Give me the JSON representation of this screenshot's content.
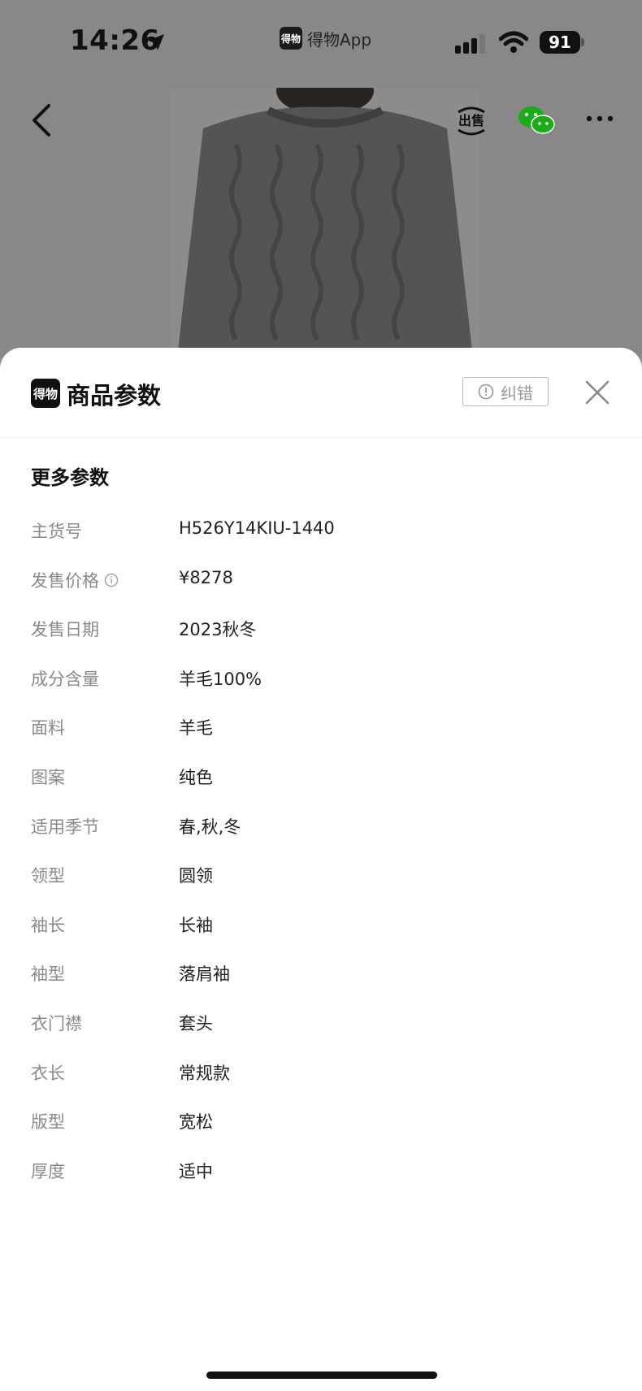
{
  "status_bar": {
    "time": "14:26",
    "app_name": "得物App",
    "app_logo_text": "得物",
    "battery": "91"
  },
  "nav": {
    "back_icon": "chevron-left-icon",
    "sell_label": "出售",
    "wechat_icon": "wechat-icon",
    "more_icon": "ellipsis-icon"
  },
  "sheet": {
    "logo_text": "得物",
    "title": "商品参数",
    "report_label": "纠错",
    "section_title": "更多参数",
    "params": [
      {
        "label": "主货号",
        "value": "H526Y14KIU-1440"
      },
      {
        "label": "发售价格",
        "value": "¥8278",
        "info": true
      },
      {
        "label": "发售日期",
        "value": "2023秋冬"
      },
      {
        "label": "成分含量",
        "value": "羊毛100%"
      },
      {
        "label": "面料",
        "value": "羊毛"
      },
      {
        "label": "图案",
        "value": "纯色"
      },
      {
        "label": "适用季节",
        "value": "春,秋,冬"
      },
      {
        "label": "领型",
        "value": "圆领"
      },
      {
        "label": "袖长",
        "value": "长袖"
      },
      {
        "label": "袖型",
        "value": "落肩袖"
      },
      {
        "label": "衣门襟",
        "value": "套头"
      },
      {
        "label": "衣长",
        "value": "常规款"
      },
      {
        "label": "版型",
        "value": "宽松"
      },
      {
        "label": "厚度",
        "value": "适中"
      }
    ]
  },
  "colors": {
    "sheet_bg": "#ffffff",
    "backdrop": "#888888",
    "label": "#8a8a8a",
    "value": "#222222",
    "wechat_green": "#1aad19"
  }
}
